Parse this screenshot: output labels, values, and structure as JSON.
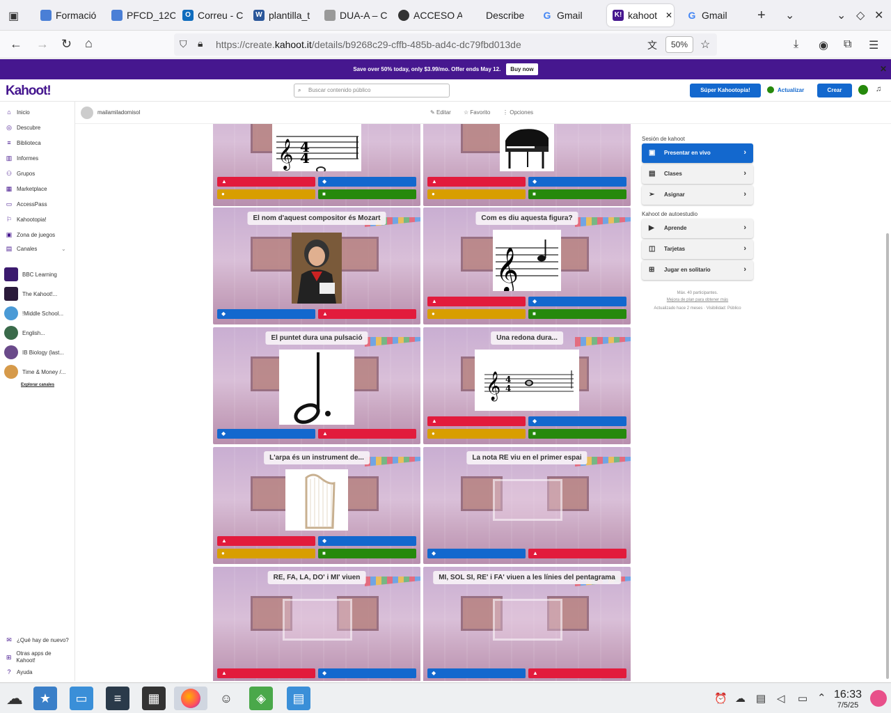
{
  "browser": {
    "tabs": [
      {
        "label": "Formació",
        "icon": "doc-icon",
        "color": "#4a7fd6"
      },
      {
        "label": "PFCD_12C",
        "icon": "doc-icon",
        "color": "#4a7fd6"
      },
      {
        "label": "Correu - C",
        "icon": "outlook-icon",
        "color": "#0f6cbd"
      },
      {
        "label": "plantilla_t",
        "icon": "word-icon",
        "color": "#2b579a"
      },
      {
        "label": "DUA-A – C",
        "icon": "cast-icon",
        "color": "#888888"
      },
      {
        "label": "ACCESO A",
        "icon": "chrome-icon",
        "color": "#333333"
      },
      {
        "label": "Describe",
        "icon": "blank-icon",
        "color": "#cccccc"
      },
      {
        "label": "Gmail",
        "icon": "google-icon",
        "color": "#4285f4"
      },
      {
        "label": "kahoot",
        "icon": "kahoot-icon",
        "color": "#46178f",
        "active": true
      },
      {
        "label": "Gmail",
        "icon": "google-icon",
        "color": "#4285f4"
      }
    ],
    "url_prefix": "https://create.",
    "url_domain": "kahoot.it",
    "url_rest": "/details/b9268c29-cffb-485b-ad4c-dc79fbd013de",
    "zoom": "50%"
  },
  "promo": {
    "text": "Save over 50% today, only $3.99/mo. Offer ends May 12.",
    "button": "Buy now"
  },
  "header": {
    "logo": "Kahoot!",
    "search_placeholder": "Buscar contenido público",
    "super_button": "Súper Kahootopia!",
    "update_button": "Actualizar",
    "create_button": "Crear"
  },
  "sidebar": {
    "items": [
      {
        "label": "Inicio",
        "icon": "home-icon"
      },
      {
        "label": "Descubre",
        "icon": "compass-icon"
      },
      {
        "label": "Biblioteca",
        "icon": "library-icon"
      },
      {
        "label": "Informes",
        "icon": "reports-icon"
      },
      {
        "label": "Grupos",
        "icon": "groups-icon"
      },
      {
        "label": "Marketplace",
        "icon": "marketplace-icon"
      },
      {
        "label": "AccessPass",
        "icon": "accesspass-icon"
      },
      {
        "label": "Kahootopia!",
        "icon": "kahootopia-icon"
      },
      {
        "label": "Zona de juegos",
        "icon": "games-icon"
      },
      {
        "label": "Canales",
        "icon": "channels-icon"
      }
    ],
    "channels": [
      {
        "label": "BBC Learning",
        "color": "#3b1a6e"
      },
      {
        "label": "The Kahoot!...",
        "color": "#2a1a3a"
      },
      {
        "label": "!Middle School...",
        "color": "#4a9ad6"
      },
      {
        "label": "English...",
        "color": "#3a6a4a"
      },
      {
        "label": "IB Biology (last...",
        "color": "#6a4a8a"
      },
      {
        "label": "Time & Money /...",
        "color": "#d69a4a"
      }
    ],
    "explore": "Explorar canales",
    "footer": [
      {
        "label": "¿Qué hay de nuevo?",
        "icon": "gift-icon"
      },
      {
        "label": "Otras apps de Kahoot!",
        "icon": "apps-icon"
      },
      {
        "label": "Ayuda",
        "icon": "help-icon"
      }
    ]
  },
  "subheader": {
    "user": "mailamiladomisol",
    "edit": "Editar",
    "favorite": "Favorito",
    "options": "Opciones"
  },
  "questions": [
    {
      "title": "",
      "image": "staff-whole-note",
      "answers": 4
    },
    {
      "title": "",
      "image": "grand-piano",
      "answers": 4
    },
    {
      "title": "El nom d'aquest compositor és Mozart",
      "image": "portrait",
      "answers": 2
    },
    {
      "title": "Com es diu aquesta figura?",
      "image": "staff-quarter-note",
      "answers": 4
    },
    {
      "title": "El puntet dura una pulsació",
      "image": "dotted-half-note",
      "answers": 2
    },
    {
      "title": "Una redona dura...",
      "image": "staff-whole-note-2",
      "answers": 4
    },
    {
      "title": "L'arpa és un instrument de...",
      "image": "harp",
      "answers": 4
    },
    {
      "title": "La nota RE viu en el primer espai",
      "image": "",
      "answers": 2
    },
    {
      "title": "RE, FA, LA, DO' i MI' viuen",
      "image": "",
      "answers": 2
    },
    {
      "title": "MI, SOL SI, RE' i FA' viuen a les línies del pentagrama",
      "image": "",
      "answers": 2
    }
  ],
  "rightpanel": {
    "session_label": "Sesión de kahoot",
    "present": "Presentar en vivo",
    "classes": "Clases",
    "assign": "Asignar",
    "self_label": "Kahoot de autoestudio",
    "learn": "Aprende",
    "cards": "Tarjetas",
    "solo": "Jugar en solitario",
    "max": "Máx. 40 participantes.",
    "upgrade": "Mejora de plan para obtener más",
    "updated": "Actualizado hace 2 meses · Visibilidad: Público"
  },
  "taskbar": {
    "time": "16:33",
    "date": "7/5/25"
  },
  "colors": {
    "kahoot_purple": "#46178f",
    "red": "#e21b3c",
    "blue": "#1368ce",
    "yellow": "#d89e00",
    "green": "#26890c"
  }
}
